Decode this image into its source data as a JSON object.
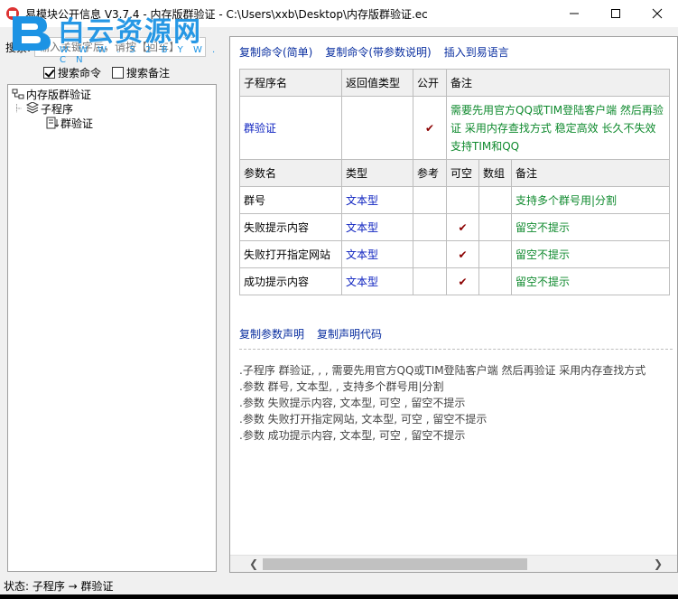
{
  "window": {
    "title": "易模块公开信息 V3.7.4 - 内存版群验证 - C:\\Users\\xxb\\Desktop\\内存版群验证.ec",
    "minimize_icon": "minimize-icon",
    "maximize_icon": "maximize-icon",
    "close_icon": "close-icon"
  },
  "watermark": {
    "text": "白云资源网",
    "url": "W W W . 5 2 B Y W . C N"
  },
  "search": {
    "label": "搜索:",
    "placeholder": "输入关键字后，请按【回车】"
  },
  "filters": {
    "search_commands": {
      "label": "搜索命令",
      "checked": true
    },
    "search_remarks": {
      "label": "搜索备注",
      "checked": false
    }
  },
  "tree": {
    "root": "内存版群验证",
    "group": "子程序",
    "item": "群验证"
  },
  "top_links": {
    "copy_simple": "复制命令(简单)",
    "copy_with_params": "复制命令(带参数说明)",
    "insert_to_eyuyan": "插入到易语言"
  },
  "sub_table": {
    "headers": {
      "name": "子程序名",
      "return_type": "返回值类型",
      "public": "公开",
      "remark": "备注"
    },
    "name": "群验证",
    "return_type": "",
    "public": "✔",
    "remark": "需要先用官方QQ或TIM登陆客户端 然后再验证 采用内存查找方式 稳定高效 长久不失效 支持TIM和QQ"
  },
  "param_table": {
    "headers": {
      "name": "参数名",
      "type": "类型",
      "ref": "参考",
      "nullable": "可空",
      "array": "数组",
      "remark": "备注"
    },
    "rows": [
      {
        "name": "群号",
        "type": "文本型",
        "ref": "",
        "nullable": "",
        "array": "",
        "remark": "支持多个群号用|分割"
      },
      {
        "name": "失败提示内容",
        "type": "文本型",
        "ref": "",
        "nullable": "✔",
        "array": "",
        "remark": "留空不提示"
      },
      {
        "name": "失败打开指定网站",
        "type": "文本型",
        "ref": "",
        "nullable": "✔",
        "array": "",
        "remark": "留空不提示"
      },
      {
        "name": "成功提示内容",
        "type": "文本型",
        "ref": "",
        "nullable": "✔",
        "array": "",
        "remark": "留空不提示"
      }
    ]
  },
  "bottom_links": {
    "copy_param_decl": "复制参数声明",
    "copy_decl_code": "复制声明代码"
  },
  "code_lines": [
    ".子程序 群验证, , , 需要先用官方QQ或TIM登陆客户端 然后再验证 采用内存查找方式",
    ".参数 群号, 文本型, , 支持多个群号用|分割",
    ".参数 失败提示内容, 文本型, 可空 , 留空不提示",
    ".参数 失败打开指定网站, 文本型, 可空 , 留空不提示",
    ".参数 成功提示内容, 文本型, 可空 , 留空不提示"
  ],
  "statusbar": {
    "text": "状态:  子程序 → 群验证"
  },
  "colors": {
    "link": "#0a2fa0",
    "type_blue": "#0a1fbf",
    "remark_green": "#0f8a2e",
    "tick_red": "#8b0000",
    "watermark_blue": "#1c93e4"
  }
}
